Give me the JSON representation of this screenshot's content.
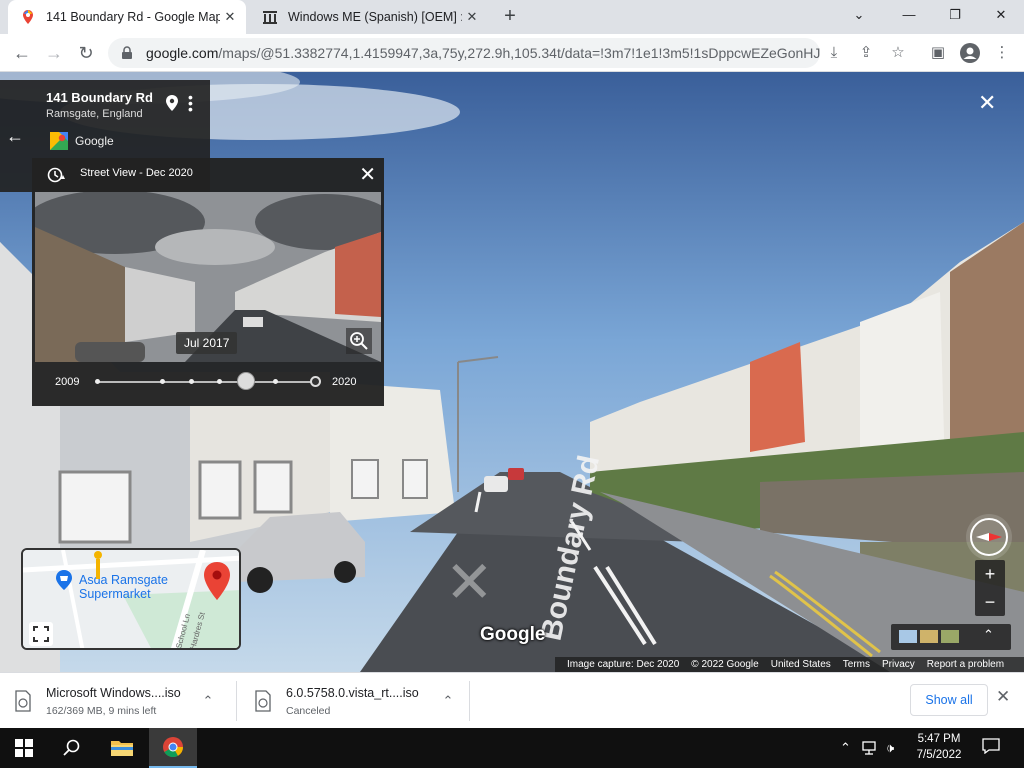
{
  "browser": {
    "tabs": [
      {
        "title": "141 Boundary Rd - Google Maps",
        "active": true
      },
      {
        "title": "Windows ME (Spanish) [OEM] : M",
        "active": false
      }
    ],
    "url_host": "google.com",
    "url_rest": "/maps/@51.3382774,1.4159947,3a,75y,272.9h,105.34t/data=!3m7!1e1!3m5!1sDppcwEZeGonHJ..."
  },
  "place": {
    "name": "141 Boundary Rd",
    "locality": "Ramsgate, England",
    "source": "Google"
  },
  "timeline": {
    "header": "Street View - Dec 2020",
    "selected_date": "Jul 2017",
    "start_year": "2009",
    "end_year": "2020",
    "selected_fraction": 0.68
  },
  "map": {
    "poi_line1": "Asda Ramsgate",
    "poi_line2": "Supermarket",
    "street1": "School Ln",
    "street2": "Hardres St"
  },
  "streetview": {
    "road_label": "Boundary Rd",
    "watermark": "Google",
    "footer": [
      "Image capture: Dec 2020",
      "© 2022 Google",
      "United States",
      "Terms",
      "Privacy",
      "Report a problem"
    ]
  },
  "downloads": [
    {
      "name": "Microsoft Windows....iso",
      "status": "162/369 MB, 9 mins left"
    },
    {
      "name": "6.0.5758.0.vista_rt....iso",
      "status": "Canceled"
    }
  ],
  "downloads_show_all": "Show all",
  "taskbar": {
    "time": "5:47 PM",
    "date": "7/5/2022"
  },
  "colors": {
    "accent": "#1a73e8",
    "pin_red": "#ea4335"
  }
}
